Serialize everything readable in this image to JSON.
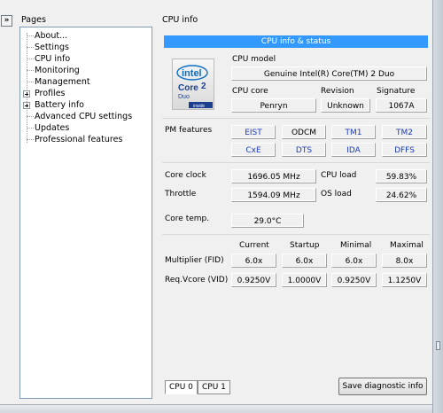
{
  "collapse_button": "»",
  "pages": {
    "title": "Pages",
    "items": [
      {
        "label": "About...",
        "expandable": false
      },
      {
        "label": "Settings",
        "expandable": false
      },
      {
        "label": "CPU info",
        "expandable": false,
        "selected": true
      },
      {
        "label": "Monitoring",
        "expandable": false
      },
      {
        "label": "Management",
        "expandable": false
      },
      {
        "label": "Profiles",
        "expandable": true
      },
      {
        "label": "Battery info",
        "expandable": true
      },
      {
        "label": "Advanced CPU settings",
        "expandable": false
      },
      {
        "label": "Updates",
        "expandable": false
      },
      {
        "label": "Professional features",
        "expandable": false
      }
    ]
  },
  "panel": {
    "title": "CPU info",
    "status_header": "CPU info & status",
    "cpu_model_label": "CPU model",
    "cpu_model": "Genuine Intel(R) Core(TM) 2 Duo",
    "cpu_core_label": "CPU core",
    "cpu_core": "Penryn",
    "revision_label": "Revision",
    "revision": "Unknown",
    "signature_label": "Signature",
    "signature": "1067A",
    "pm_label": "PM features",
    "pm_features": [
      "EIST",
      "ODCM",
      "TM1",
      "TM2",
      "CxE",
      "DTS",
      "IDA",
      "DFFS"
    ],
    "core_clock_label": "Core clock",
    "core_clock": "1696.05 MHz",
    "cpu_load_label": "CPU load",
    "cpu_load": "59.83%",
    "throttle_label": "Throttle",
    "throttle": "1594.09 MHz",
    "os_load_label": "OS load",
    "os_load": "24.62%",
    "core_temp_label": "Core temp.",
    "core_temp": "29.0°C",
    "multiplier": {
      "headers": [
        "Current",
        "Startup",
        "Minimal",
        "Maximal"
      ],
      "rows": [
        {
          "label": "Multiplier (FID)",
          "values": [
            "6.0x",
            "6.0x",
            "6.0x",
            "8.0x"
          ]
        },
        {
          "label": "Req.Vcore (VID)",
          "values": [
            "0.9250V",
            "1.0000V",
            "0.9250V",
            "1.1250V"
          ]
        }
      ]
    }
  },
  "logo": {
    "brand": "intel",
    "line1": "Core",
    "line2": "2",
    "line3": "Duo",
    "tag": "inside",
    "colors": {
      "blue": "#0a6cc4",
      "dark": "#1b3f8f"
    }
  },
  "tabs": [
    "CPU 0",
    "CPU 1"
  ],
  "save_button": "Save diagnostic info"
}
